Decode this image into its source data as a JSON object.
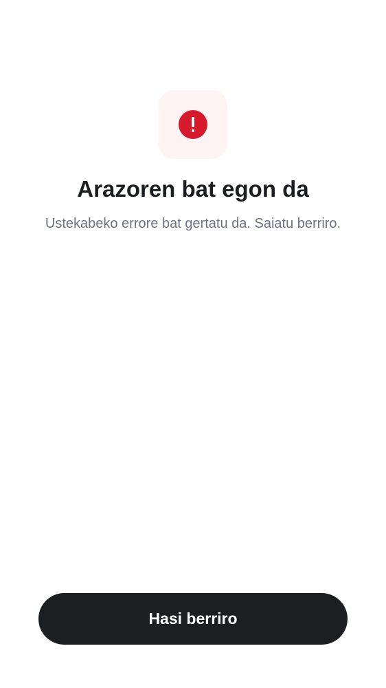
{
  "error": {
    "icon": "exclamation-circle-icon",
    "title": "Arazoren bat egon da",
    "message": "Ustekabeko errore bat gertatu da. Saiatu berriro.",
    "restart_label": "Hasi berriro",
    "accent": "#d71a2b"
  }
}
